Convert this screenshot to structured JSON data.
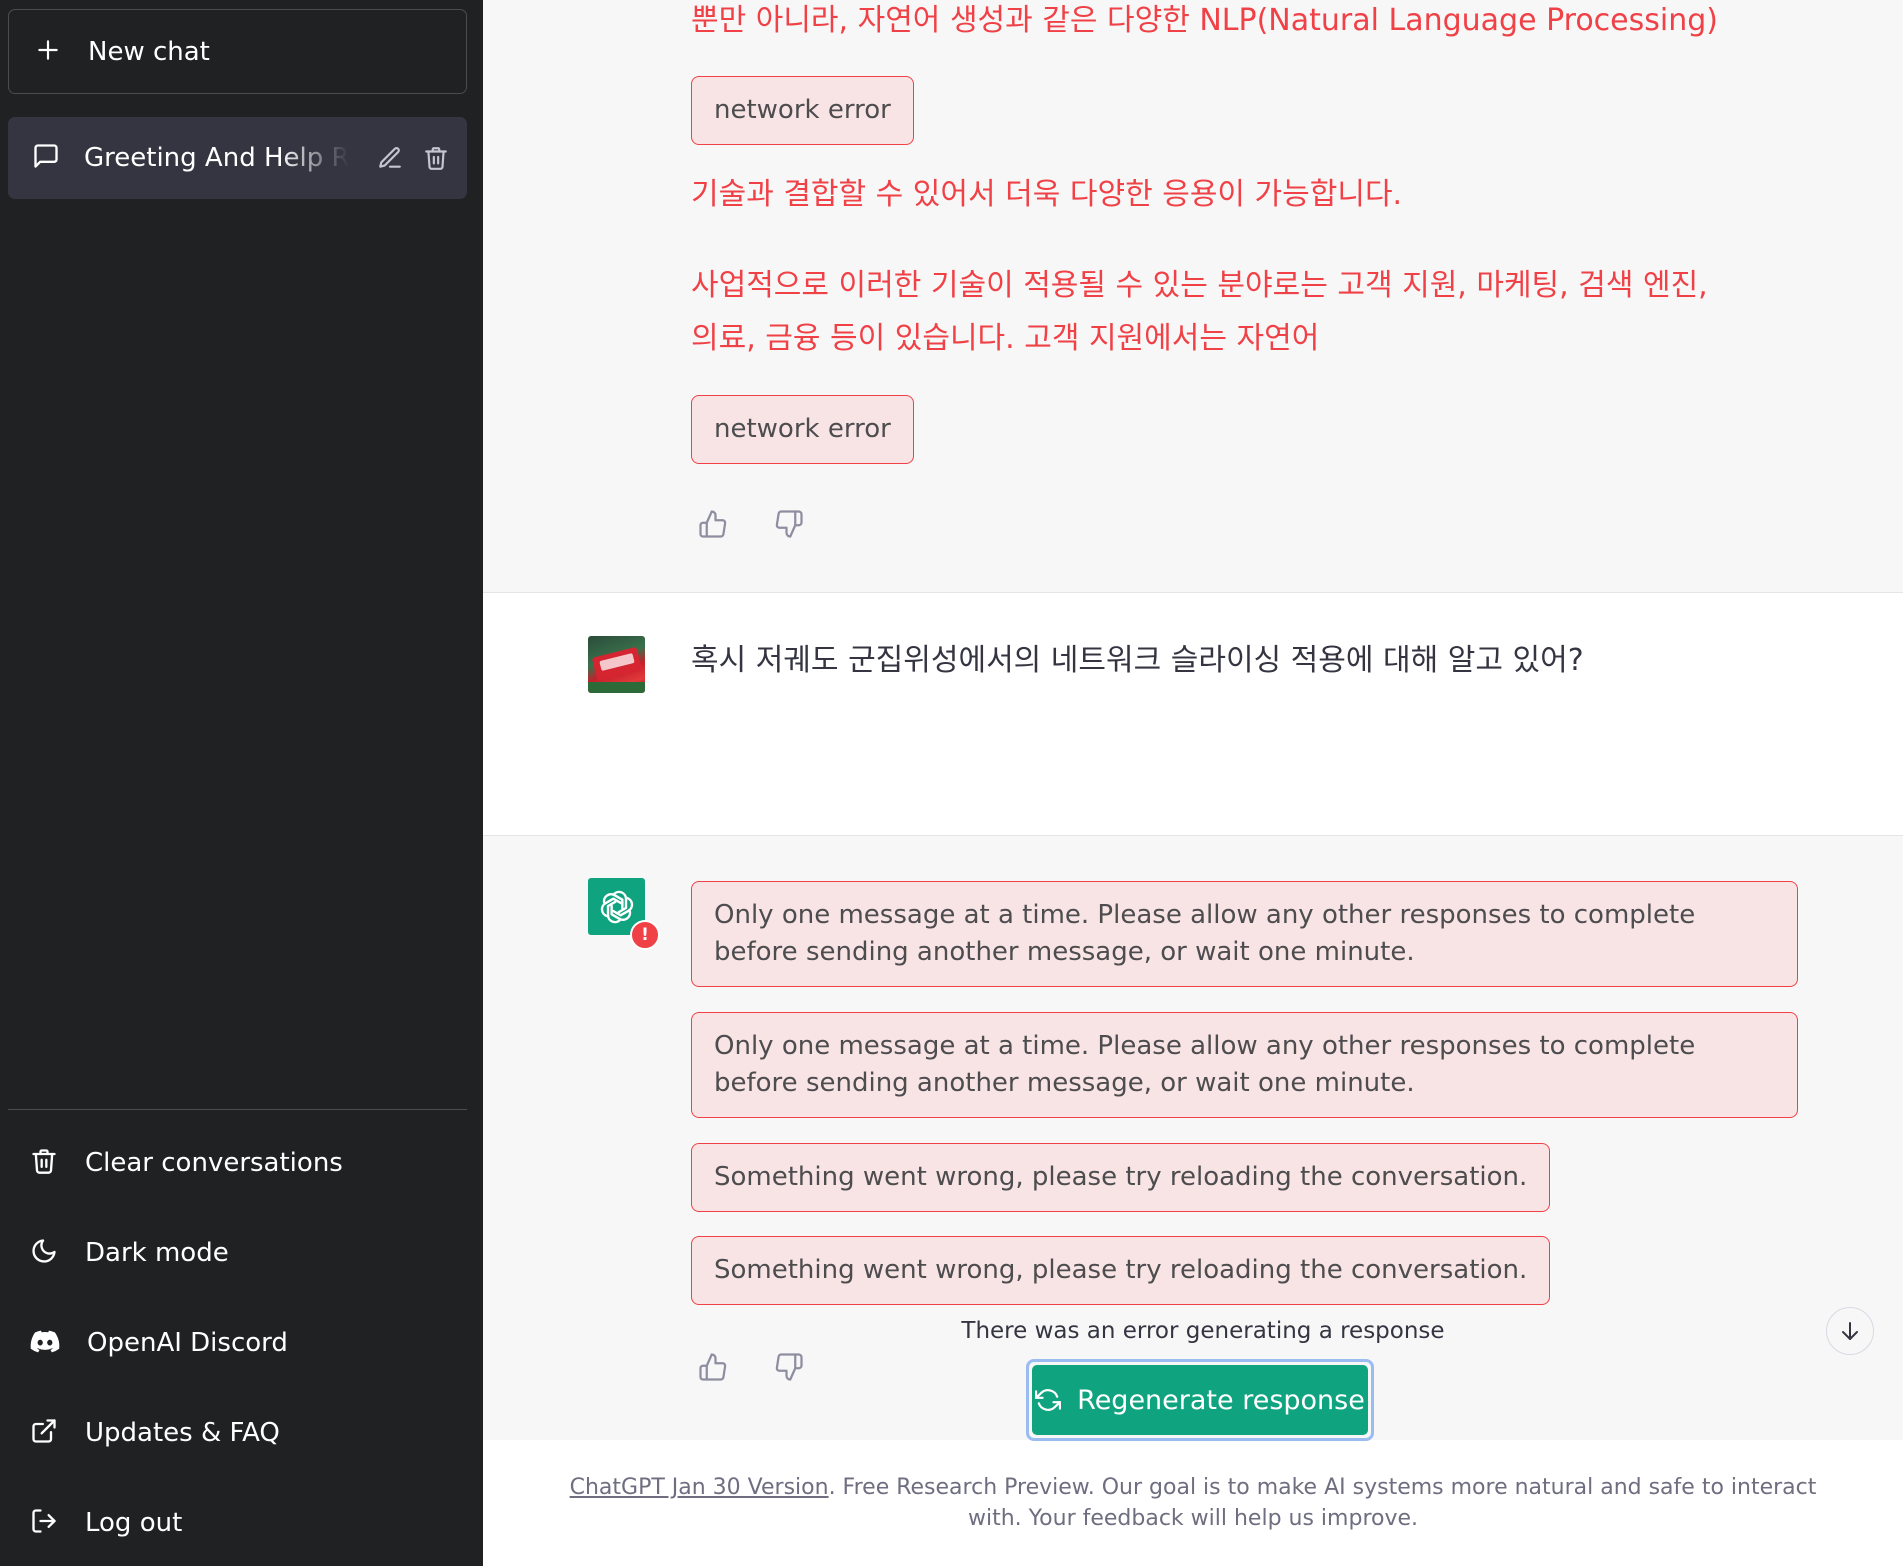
{
  "sidebar": {
    "new_chat_label": "New chat",
    "conversation_title": "Greeting And Help Request",
    "menu": [
      {
        "label": "Clear conversations",
        "icon": "trash-icon"
      },
      {
        "label": "Dark mode",
        "icon": "moon-icon"
      },
      {
        "label": "OpenAI Discord",
        "icon": "discord-icon"
      },
      {
        "label": "Updates & FAQ",
        "icon": "external-link-icon"
      },
      {
        "label": "Log out",
        "icon": "logout-icon"
      }
    ]
  },
  "conversation": {
    "assistant_prev": {
      "line1": "뿐만 아니라, 자연어 생성과 같은 다양한 NLP(Natural Language Processing)",
      "error1": "network error",
      "line2": "기술과 결합할 수 있어서 더욱 다양한 응용이 가능합니다.",
      "line3a": "사업적으로 이러한 기술이 적용될 수 있는 분야로는 고객 지원, 마케팅, 검색 엔진,",
      "line3b": "의료, 금융 등이 있습니다. 고객 지원에서는 자연어",
      "error2": "network error"
    },
    "user_message": "혹시 저궤도 군집위성에서의 네트워크 슬라이싱 적용에 대해 알고 있어?",
    "assistant_errors": [
      "Only one message at a time. Please allow any other responses to complete before sending another message, or wait one minute.",
      "Only one message at a time. Please allow any other responses to complete before sending another message, or wait one minute.",
      "Something went wrong, please try reloading the conversation.",
      "Something went wrong, please try reloading the conversation."
    ],
    "error_notice": "There was an error generating a response",
    "regenerate_label": "Regenerate response"
  },
  "footer": {
    "version_link": "ChatGPT Jan 30 Version",
    "text": ". Free Research Preview. Our goal is to make AI systems more natural and safe to interact with. Your feedback will help us improve."
  },
  "colors": {
    "sidebar_bg": "#202123",
    "accent": "#10a37f",
    "error": "#ef4146",
    "error_bg": "#f9e4e5"
  }
}
